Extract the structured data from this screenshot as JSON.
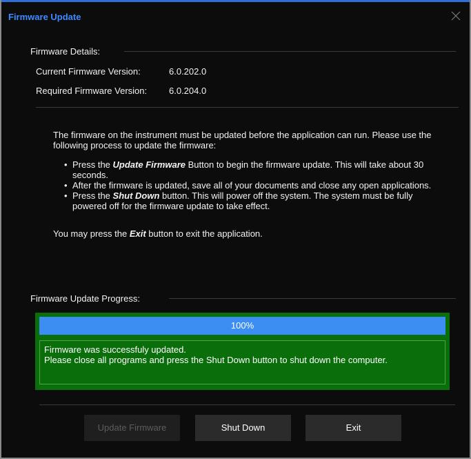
{
  "window": {
    "title": "Firmware Update"
  },
  "details": {
    "section_label": "Firmware Details:",
    "current_label": "Current Firmware Version:",
    "current_value": "6.0.202.0",
    "required_label": "Required Firmware Version:",
    "required_value": "6.0.204.0"
  },
  "instructions": {
    "intro": "The firmware on the instrument must be updated before the application can run. Please use the following process to update the firmware:",
    "bullet1_pre": "Press the ",
    "bullet1_emph": "Update Firmware",
    "bullet1_post": " Button to begin the firmware update.  This will take about 30 seconds.",
    "bullet2": "After the firmware is updated, save all of your documents and close any open applications.",
    "bullet3_pre": "Press the ",
    "bullet3_emph": "Shut Down",
    "bullet3_post": " button.  This will power off the system.  The system must be fully powered off for the firmware update to take effect.",
    "exit_pre": "You may press the ",
    "exit_emph": "Exit",
    "exit_post": " button to exit the application."
  },
  "progress": {
    "section_label": "Firmware Update Progress:",
    "percent_text": "100%",
    "percent_value": 100,
    "message_line1": "Firmware was successfuly updated.",
    "message_line2": "Please close all programs and press the Shut Down button to shut down the computer."
  },
  "buttons": {
    "update": "Update Firmware",
    "shutdown": "Shut Down",
    "exit": "Exit"
  },
  "colors": {
    "accent": "#3d8bff",
    "progress_fill": "#3d8ef2",
    "success_green": "#0a6e0a"
  },
  "icons": {
    "close": "close-icon"
  }
}
